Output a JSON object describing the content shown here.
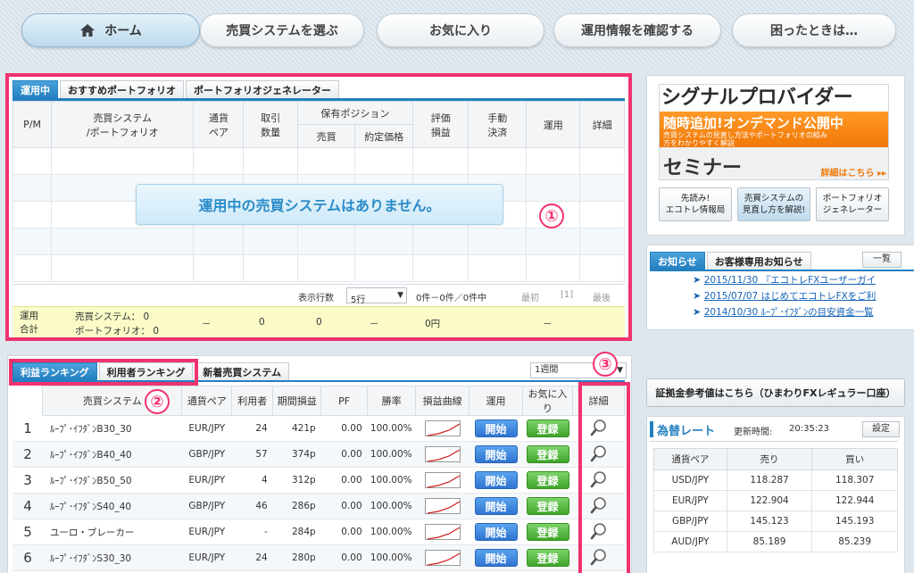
{
  "nav": {
    "home": "ホーム",
    "choose": "売買システムを選ぶ",
    "favorites": "お気に入り",
    "info": "運用情報を確認する",
    "help": "困ったときは…"
  },
  "portfolio": {
    "tabs": [
      "運用中",
      "おすすめポートフォリオ",
      "ポートフォリオジェネレーター"
    ],
    "headers": {
      "pm": "P/M",
      "system": "売買システム\n/ポートフォリオ",
      "pair": "通貨\nペア",
      "qty": "取引\n数量",
      "position": "保有ポジション",
      "buysell": "売買",
      "price": "約定価格",
      "eval": "評価\n損益",
      "manual": "手動\n決済",
      "operate": "運用",
      "detail": "詳細"
    },
    "empty_message": "運用中の売買システムはありません。",
    "pager": {
      "rows_label": "表示行数",
      "rows_value": "5行",
      "count": "0件－0件／0件中",
      "first": "最初",
      "page": "[1]",
      "last": "最後"
    },
    "totals": {
      "label": "運用\n合計",
      "systems": "売買システム：  0",
      "portfolios": "ポートフォリオ：  0",
      "pair": "－",
      "qty": "0",
      "buysell": "0",
      "price": "－",
      "eval": "0円",
      "rest": "－"
    }
  },
  "ranking": {
    "tabs": [
      "利益ランキング",
      "利用者ランキング",
      "新着売買システム"
    ],
    "period": "1週間",
    "headers": [
      "売買システム",
      "通貨ペア",
      "利用者",
      "期間損益",
      "PF",
      "勝率",
      "損益曲線",
      "運用",
      "お気に入り",
      "詳細"
    ],
    "start_label": "開始",
    "register_label": "登録",
    "rows": [
      {
        "rank": "1",
        "name": "ﾙｰﾌﾟ･ｲﾌﾀﾞﾝB30_30",
        "pair": "EUR/JPY",
        "users": "24",
        "profit": "421p",
        "pf": "0.00",
        "win": "100.00%"
      },
      {
        "rank": "2",
        "name": "ﾙｰﾌﾟ･ｲﾌﾀﾞﾝB40_40",
        "pair": "GBP/JPY",
        "users": "57",
        "profit": "374p",
        "pf": "0.00",
        "win": "100.00%"
      },
      {
        "rank": "3",
        "name": "ﾙｰﾌﾟ･ｲﾌﾀﾞﾝB50_50",
        "pair": "EUR/JPY",
        "users": "4",
        "profit": "312p",
        "pf": "0.00",
        "win": "100.00%"
      },
      {
        "rank": "4",
        "name": "ﾙｰﾌﾟ･ｲﾌﾀﾞﾝS40_40",
        "pair": "GBP/JPY",
        "users": "46",
        "profit": "286p",
        "pf": "0.00",
        "win": "100.00%"
      },
      {
        "rank": "5",
        "name": "ユーロ・ブレーカー",
        "pair": "EUR/JPY",
        "users": "-",
        "profit": "284p",
        "pf": "0.00",
        "win": "100.00%"
      },
      {
        "rank": "6",
        "name": "ﾙｰﾌﾟ･ｲﾌﾀﾞﾝS30_30",
        "pair": "EUR/JPY",
        "users": "24",
        "profit": "280p",
        "pf": "0.00",
        "win": "100.00%"
      }
    ]
  },
  "annotations": [
    "①",
    "②",
    "③"
  ],
  "banner": {
    "title": "シグナルプロバイダー",
    "sub1": "随時追加!オンデマンド公開中",
    "sub2": "売買システムの見直し方法やポートフォリオの組み",
    "sub3": "方をわかりやすく解説",
    "seminar": "セミナー",
    "more": "詳細はこちら ▸▸"
  },
  "side_buttons": [
    {
      "l1": "先読み!",
      "l2": "エコトレ情報局"
    },
    {
      "l1": "売買システムの",
      "l2": "見直し方を解説!"
    },
    {
      "l1": "ポートフォリオ",
      "l2": "ジェネレーター"
    }
  ],
  "news": {
    "tabs": [
      "お知らせ",
      "お客様専用お知らせ"
    ],
    "list_button": "一覧",
    "items": [
      "2015/11/30 『エコトレFXユーザーガイ",
      "2015/07/07 はじめてエコトレFXをご利",
      "2014/10/30 ﾙｰﾌﾟ･ｲﾌﾀﾞﾝの目安資金一覧"
    ]
  },
  "margin_button": "証拠金参考値はこちら（ひまわりFXレギュラー口座）",
  "fx": {
    "title": "為替レート",
    "updated_label": "更新時間:",
    "updated": "20:35:23",
    "settings": "設定",
    "headers": [
      "通貨ペア",
      "売り",
      "買い"
    ],
    "rows": [
      {
        "pair": "USD/JPY",
        "sell": "118.287",
        "buy": "118.307"
      },
      {
        "pair": "EUR/JPY",
        "sell": "122.904",
        "buy": "122.944"
      },
      {
        "pair": "GBP/JPY",
        "sell": "145.123",
        "buy": "145.193"
      },
      {
        "pair": "AUD/JPY",
        "sell": "85.189",
        "buy": "85.239"
      }
    ]
  },
  "colors": {
    "accent_blue": "#237fc0",
    "highlight_pink": "#f0326e",
    "start_button": "#2f74d1",
    "register_button": "#3ea529"
  }
}
